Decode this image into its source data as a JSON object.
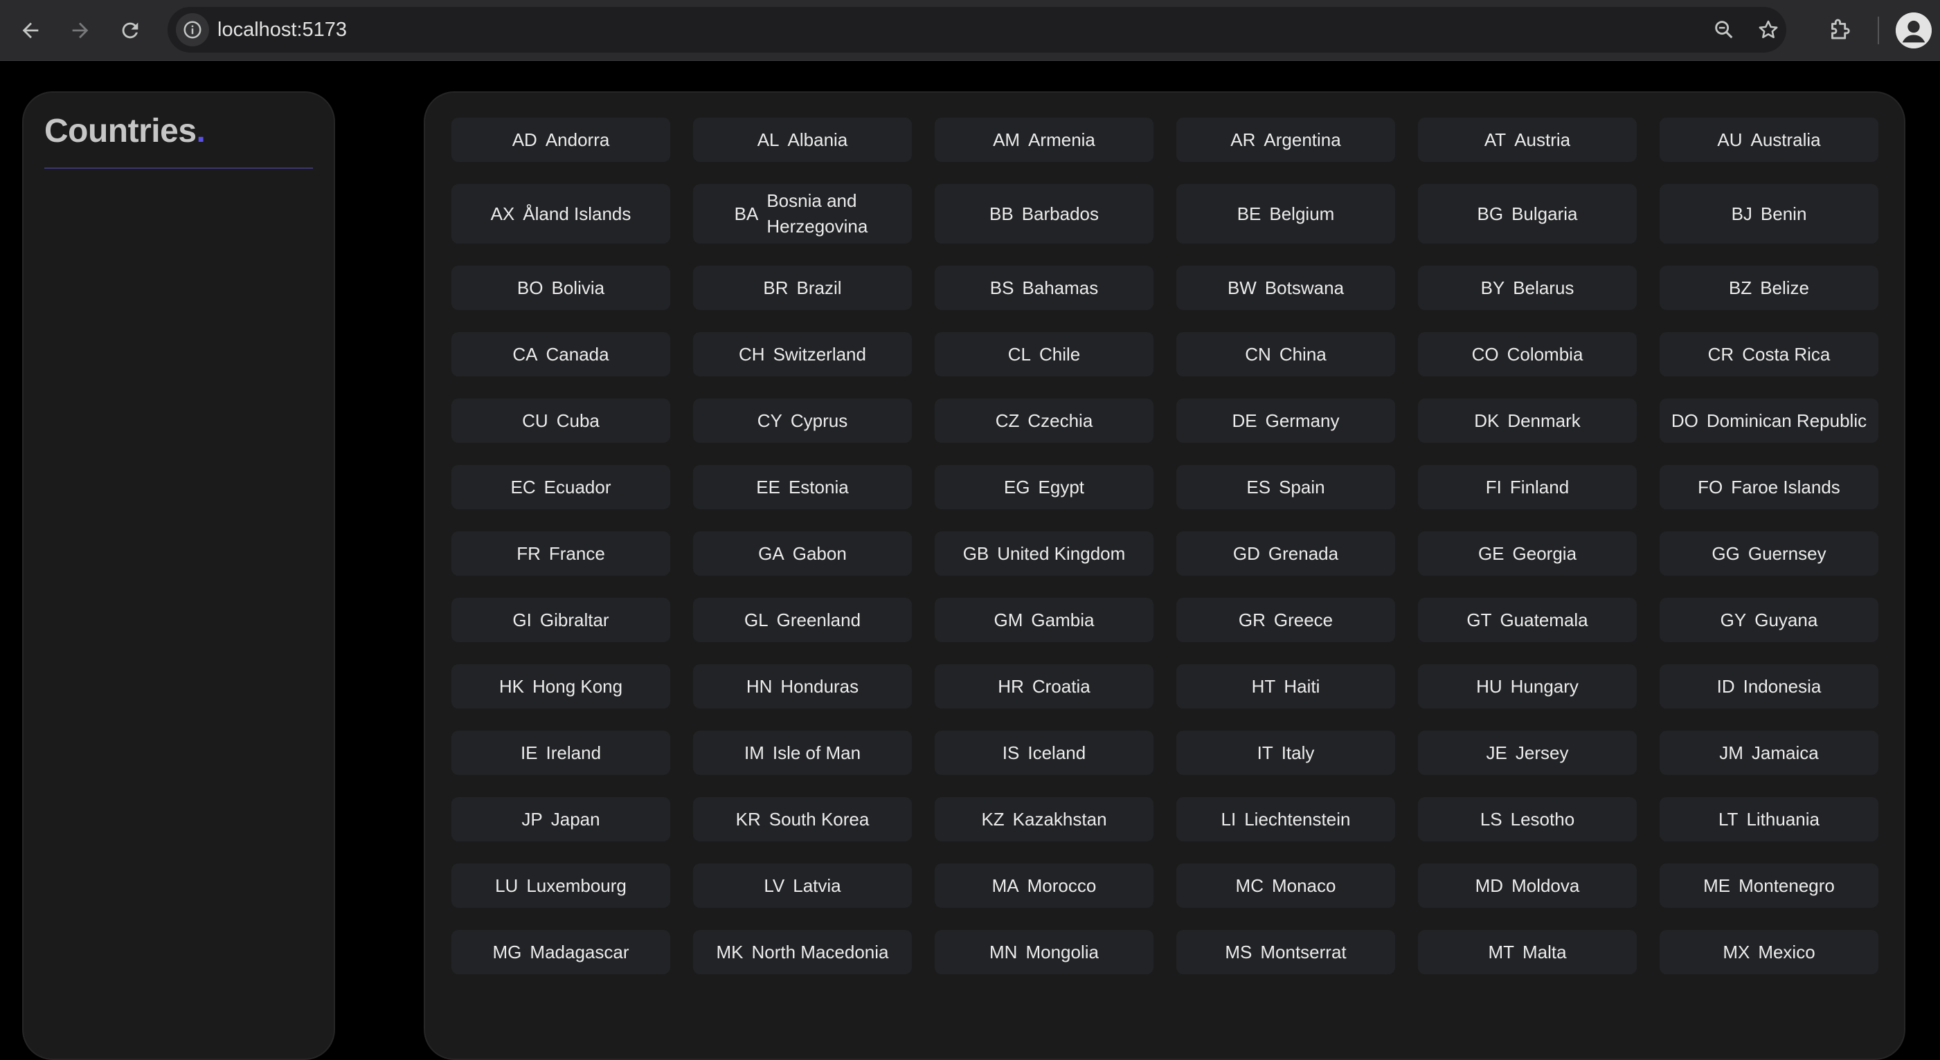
{
  "browser": {
    "url": "localhost:5173",
    "icons": {
      "back": "arrow-left-icon",
      "forward": "arrow-right-icon",
      "reload": "reload-icon",
      "site_info": "info-icon",
      "zoom": "zoom-icon",
      "bookmark": "star-icon",
      "extensions": "puzzle-icon",
      "profile": "person-icon"
    }
  },
  "sidebar": {
    "title": "Countries",
    "title_dot": ".",
    "accent_color": "#5b50e6"
  },
  "countries": [
    {
      "code": "AD",
      "name": "Andorra"
    },
    {
      "code": "AL",
      "name": "Albania"
    },
    {
      "code": "AM",
      "name": "Armenia"
    },
    {
      "code": "AR",
      "name": "Argentina"
    },
    {
      "code": "AT",
      "name": "Austria"
    },
    {
      "code": "AU",
      "name": "Australia"
    },
    {
      "code": "AX",
      "name": "Åland Islands"
    },
    {
      "code": "BA",
      "name": "Bosnia and Herzegovina"
    },
    {
      "code": "BB",
      "name": "Barbados"
    },
    {
      "code": "BE",
      "name": "Belgium"
    },
    {
      "code": "BG",
      "name": "Bulgaria"
    },
    {
      "code": "BJ",
      "name": "Benin"
    },
    {
      "code": "BO",
      "name": "Bolivia"
    },
    {
      "code": "BR",
      "name": "Brazil"
    },
    {
      "code": "BS",
      "name": "Bahamas"
    },
    {
      "code": "BW",
      "name": "Botswana"
    },
    {
      "code": "BY",
      "name": "Belarus"
    },
    {
      "code": "BZ",
      "name": "Belize"
    },
    {
      "code": "CA",
      "name": "Canada"
    },
    {
      "code": "CH",
      "name": "Switzerland"
    },
    {
      "code": "CL",
      "name": "Chile"
    },
    {
      "code": "CN",
      "name": "China"
    },
    {
      "code": "CO",
      "name": "Colombia"
    },
    {
      "code": "CR",
      "name": "Costa Rica"
    },
    {
      "code": "CU",
      "name": "Cuba"
    },
    {
      "code": "CY",
      "name": "Cyprus"
    },
    {
      "code": "CZ",
      "name": "Czechia"
    },
    {
      "code": "DE",
      "name": "Germany"
    },
    {
      "code": "DK",
      "name": "Denmark"
    },
    {
      "code": "DO",
      "name": "Dominican Republic"
    },
    {
      "code": "EC",
      "name": "Ecuador"
    },
    {
      "code": "EE",
      "name": "Estonia"
    },
    {
      "code": "EG",
      "name": "Egypt"
    },
    {
      "code": "ES",
      "name": "Spain"
    },
    {
      "code": "FI",
      "name": "Finland"
    },
    {
      "code": "FO",
      "name": "Faroe Islands"
    },
    {
      "code": "FR",
      "name": "France"
    },
    {
      "code": "GA",
      "name": "Gabon"
    },
    {
      "code": "GB",
      "name": "United Kingdom"
    },
    {
      "code": "GD",
      "name": "Grenada"
    },
    {
      "code": "GE",
      "name": "Georgia"
    },
    {
      "code": "GG",
      "name": "Guernsey"
    },
    {
      "code": "GI",
      "name": "Gibraltar"
    },
    {
      "code": "GL",
      "name": "Greenland"
    },
    {
      "code": "GM",
      "name": "Gambia"
    },
    {
      "code": "GR",
      "name": "Greece"
    },
    {
      "code": "GT",
      "name": "Guatemala"
    },
    {
      "code": "GY",
      "name": "Guyana"
    },
    {
      "code": "HK",
      "name": "Hong Kong"
    },
    {
      "code": "HN",
      "name": "Honduras"
    },
    {
      "code": "HR",
      "name": "Croatia"
    },
    {
      "code": "HT",
      "name": "Haiti"
    },
    {
      "code": "HU",
      "name": "Hungary"
    },
    {
      "code": "ID",
      "name": "Indonesia"
    },
    {
      "code": "IE",
      "name": "Ireland"
    },
    {
      "code": "IM",
      "name": "Isle of Man"
    },
    {
      "code": "IS",
      "name": "Iceland"
    },
    {
      "code": "IT",
      "name": "Italy"
    },
    {
      "code": "JE",
      "name": "Jersey"
    },
    {
      "code": "JM",
      "name": "Jamaica"
    },
    {
      "code": "JP",
      "name": "Japan"
    },
    {
      "code": "KR",
      "name": "South Korea"
    },
    {
      "code": "KZ",
      "name": "Kazakhstan"
    },
    {
      "code": "LI",
      "name": "Liechtenstein"
    },
    {
      "code": "LS",
      "name": "Lesotho"
    },
    {
      "code": "LT",
      "name": "Lithuania"
    },
    {
      "code": "LU",
      "name": "Luxembourg"
    },
    {
      "code": "LV",
      "name": "Latvia"
    },
    {
      "code": "MA",
      "name": "Morocco"
    },
    {
      "code": "MC",
      "name": "Monaco"
    },
    {
      "code": "MD",
      "name": "Moldova"
    },
    {
      "code": "ME",
      "name": "Montenegro"
    },
    {
      "code": "MG",
      "name": "Madagascar"
    },
    {
      "code": "MK",
      "name": "North Macedonia"
    },
    {
      "code": "MN",
      "name": "Mongolia"
    },
    {
      "code": "MS",
      "name": "Montserrat"
    },
    {
      "code": "MT",
      "name": "Malta"
    },
    {
      "code": "MX",
      "name": "Mexico"
    }
  ]
}
